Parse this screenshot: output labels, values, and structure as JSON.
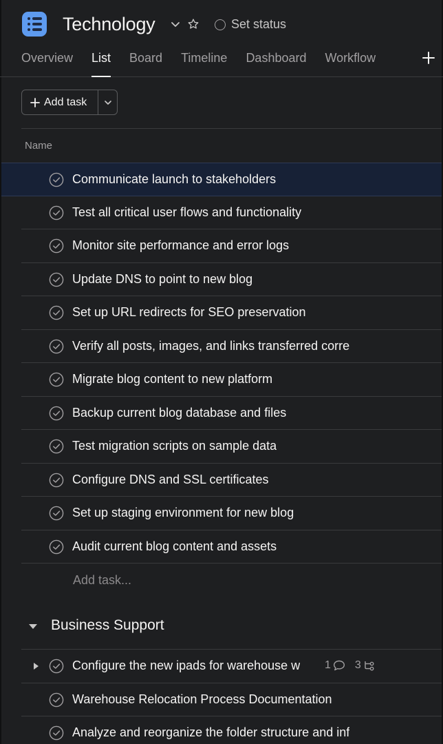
{
  "header": {
    "project_title": "Technology",
    "status_label": "Set status",
    "app_icon": "list-app-icon",
    "brand_color": "#5e9bf0"
  },
  "tabs": [
    {
      "label": "Overview",
      "active": false
    },
    {
      "label": "List",
      "active": true
    },
    {
      "label": "Board",
      "active": false
    },
    {
      "label": "Timeline",
      "active": false
    },
    {
      "label": "Dashboard",
      "active": false
    },
    {
      "label": "Workflow",
      "active": false
    }
  ],
  "toolbar": {
    "add_task_label": "Add task"
  },
  "columns": {
    "name": "Name"
  },
  "tasks": [
    {
      "name": "Communicate launch to stakeholders",
      "selected": true
    },
    {
      "name": "Test all critical user flows and functionality"
    },
    {
      "name": "Monitor site performance and error logs"
    },
    {
      "name": "Update DNS to point to new blog"
    },
    {
      "name": "Set up URL redirects for SEO preservation"
    },
    {
      "name": "Verify all posts, images, and links transferred corre"
    },
    {
      "name": "Migrate blog content to new platform"
    },
    {
      "name": "Backup current blog database and files"
    },
    {
      "name": "Test migration scripts on sample data"
    },
    {
      "name": "Configure DNS and SSL certificates"
    },
    {
      "name": "Set up staging environment for new blog"
    },
    {
      "name": "Audit current blog content and assets"
    }
  ],
  "add_task_inline": "Add task...",
  "section": {
    "title": "Business Support",
    "tasks": [
      {
        "name": "Configure the new ipads for warehouse w",
        "comments": "1",
        "subtasks": "3"
      },
      {
        "name": "Warehouse Relocation Process Documentation"
      },
      {
        "name": "Analyze and reorganize the folder structure and inf"
      }
    ]
  }
}
